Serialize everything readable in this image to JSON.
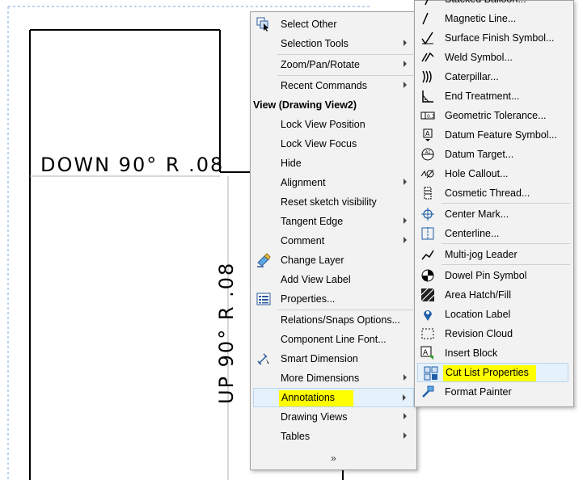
{
  "drawing": {
    "label_horizontal": "DOWN 90° R .08",
    "label_vertical": "UP 90° R .08"
  },
  "main_menu": {
    "top_items": [
      {
        "label": "Select Other",
        "icon": "select-other-icon",
        "submenu": false
      },
      {
        "label": "Selection Tools",
        "icon": "",
        "submenu": true
      },
      {
        "label": "Zoom/Pan/Rotate",
        "icon": "",
        "submenu": true
      },
      {
        "label": "Recent Commands",
        "icon": "",
        "submenu": true
      }
    ],
    "section_header": "View (Drawing View2)",
    "items": [
      {
        "label": "Lock View Position",
        "submenu": false
      },
      {
        "label": "Lock View Focus",
        "submenu": false
      },
      {
        "label": "Hide",
        "submenu": false
      },
      {
        "label": "Alignment",
        "submenu": true
      },
      {
        "label": "Reset sketch visibility",
        "submenu": false
      },
      {
        "label": "Tangent Edge",
        "submenu": true
      },
      {
        "label": "Comment",
        "submenu": true
      },
      {
        "label": "Change Layer",
        "icon": "change-layer-icon",
        "submenu": false
      },
      {
        "label": "Add View Label",
        "submenu": false
      },
      {
        "label": "Properties...",
        "icon": "properties-icon",
        "submenu": false
      },
      {
        "label": "Relations/Snaps Options...",
        "submenu": false
      },
      {
        "label": "Component Line Font...",
        "submenu": false
      },
      {
        "label": "Smart Dimension",
        "icon": "smart-dimension-icon",
        "submenu": false
      },
      {
        "label": "More Dimensions",
        "submenu": true
      },
      {
        "label": "Annotations",
        "submenu": true,
        "active": true
      },
      {
        "label": "Drawing Views",
        "submenu": true
      },
      {
        "label": "Tables",
        "submenu": true
      }
    ],
    "expand_glyph": "»"
  },
  "annotations_menu": {
    "items": [
      {
        "label": "Stacked Balloon...",
        "icon": "stacked-balloon-icon"
      },
      {
        "label": "Magnetic Line...",
        "icon": "magnetic-line-icon"
      },
      {
        "label": "Surface Finish Symbol...",
        "icon": "surface-finish-icon"
      },
      {
        "label": "Weld Symbol...",
        "icon": "weld-symbol-icon"
      },
      {
        "label": "Caterpillar...",
        "icon": "caterpillar-icon"
      },
      {
        "label": "End Treatment...",
        "icon": "end-treatment-icon"
      },
      {
        "label": "Geometric Tolerance...",
        "icon": "geometric-tolerance-icon"
      },
      {
        "label": "Datum Feature Symbol...",
        "icon": "datum-feature-icon"
      },
      {
        "label": "Datum Target...",
        "icon": "datum-target-icon"
      },
      {
        "label": "Hole Callout...",
        "icon": "hole-callout-icon"
      },
      {
        "label": "Cosmetic Thread...",
        "icon": "cosmetic-thread-icon"
      },
      {
        "label": "Center Mark...",
        "icon": "center-mark-icon"
      },
      {
        "label": "Centerline...",
        "icon": "centerline-icon"
      },
      {
        "label": "Multi-jog Leader",
        "icon": "multi-jog-leader-icon"
      },
      {
        "label": "Dowel Pin Symbol",
        "icon": "dowel-pin-icon"
      },
      {
        "label": "Area Hatch/Fill",
        "icon": "area-hatch-icon"
      },
      {
        "label": "Location Label",
        "icon": "location-label-icon"
      },
      {
        "label": "Revision Cloud",
        "icon": "revision-cloud-icon"
      },
      {
        "label": "Insert Block",
        "icon": "insert-block-icon"
      },
      {
        "label": "Cut List Properties",
        "icon": "cut-list-properties-icon",
        "hover": true
      },
      {
        "label": "Format Painter",
        "icon": "format-painter-icon"
      }
    ]
  },
  "colors": {
    "highlight_yellow": "#ffff00",
    "hover_bg": "#e5f1fb",
    "menu_bg": "#f2f2f2",
    "icon_blue": "#1f5fa8"
  }
}
